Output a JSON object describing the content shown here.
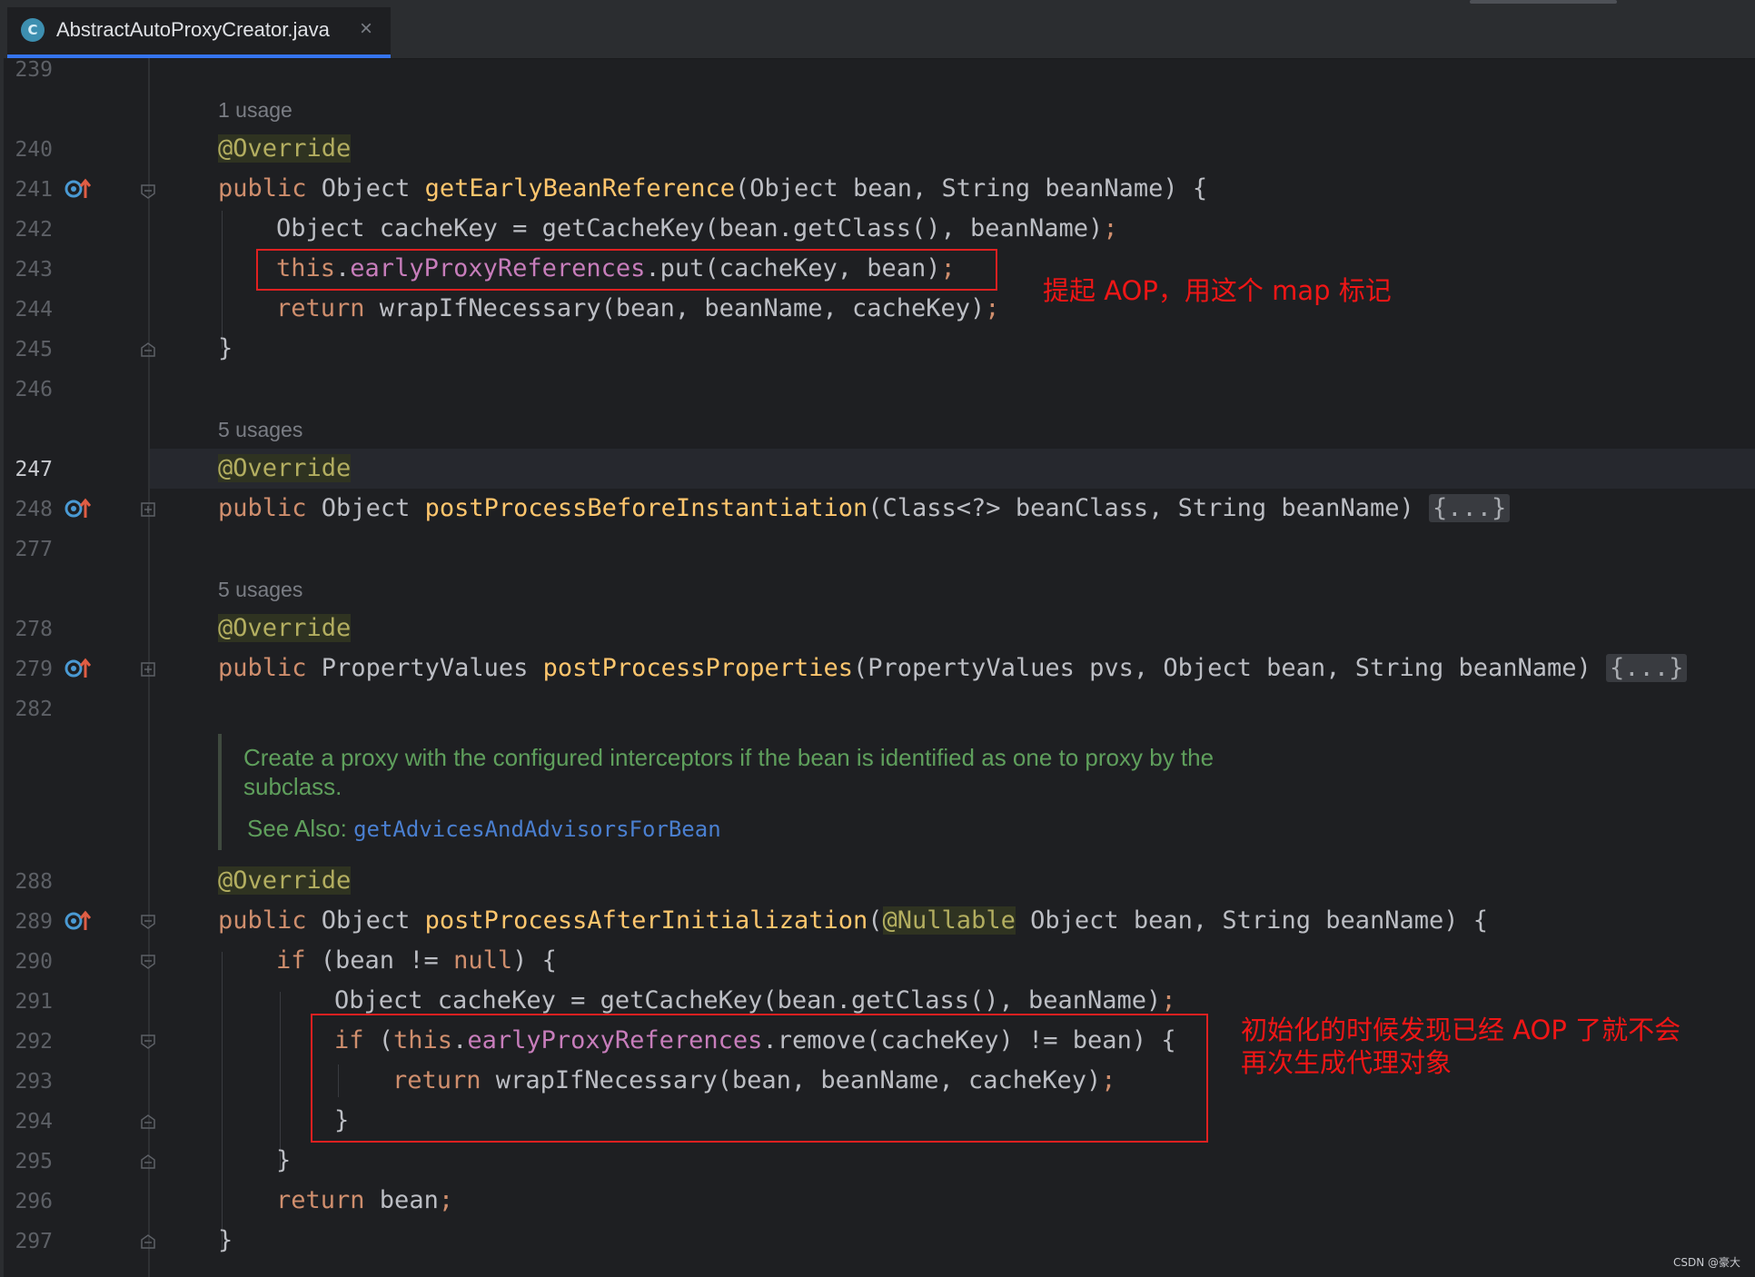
{
  "tab": {
    "icon_letter": "C",
    "title": "AbstractAutoProxyCreator.java",
    "close_glyph": "×"
  },
  "line_numbers": {
    "l239": "239",
    "l240": "240",
    "l241": "241",
    "l242": "242",
    "l243": "243",
    "l244": "244",
    "l245": "245",
    "l246": "246",
    "l247": "247",
    "l248": "248",
    "l277": "277",
    "l278": "278",
    "l279": "279",
    "l282": "282",
    "l288": "288",
    "l289": "289",
    "l290": "290",
    "l291": "291",
    "l292": "292",
    "l293": "293",
    "l294": "294",
    "l295": "295",
    "l296": "296",
    "l297": "297"
  },
  "hints": {
    "usage1": "1 usage",
    "usages5a": "5 usages",
    "usages5b": "5 usages"
  },
  "code": {
    "l240_ann": "@Override",
    "l241_pub": "public",
    "l241_type": " Object ",
    "l241_name": "getEarlyBeanReference",
    "l241_rest": "(Object bean, String beanName) {",
    "l242_a": "Object cacheKey = getCacheKey(bean.getClass(), beanName)",
    "l242_semi": ";",
    "l243_this": "this",
    "l243_dot": ".",
    "l243_field": "earlyProxyReferences",
    "l243_rest": ".put(cacheKey, bean)",
    "l243_semi": ";",
    "l244_ret": "return",
    "l244_rest": " wrapIfNecessary(bean, beanName, cacheKey)",
    "l244_semi": ";",
    "l245": "}",
    "l247_ann": "@Override",
    "l248_pub": "public",
    "l248_type": " Object ",
    "l248_name": "postProcessBeforeInstantiation",
    "l248_rest": "(Class<?> beanClass, String beanName) ",
    "l248_fold": "{...}",
    "l278_ann": "@Override",
    "l279_pub": "public",
    "l279_type": " PropertyValues ",
    "l279_name": "postProcessProperties",
    "l279_rest": "(PropertyValues pvs, Object bean, String beanName) ",
    "l279_fold": "{...}",
    "l288_ann": "@Override",
    "l289_pub": "public",
    "l289_type": " Object ",
    "l289_name": "postProcessAfterInitialization",
    "l289_p": "(",
    "l289_ann": "@Nullable",
    "l289_rest": " Object bean, String beanName) {",
    "l290_if": "if",
    "l290_a": " (bean != ",
    "l290_null": "null",
    "l290_b": ") {",
    "l291_a": "Object cacheKey = getCacheKey(bean.getClass(), beanName)",
    "l291_semi": ";",
    "l292_if": "if",
    "l292_a": " (",
    "l292_this": "this",
    "l292_dot": ".",
    "l292_field": "earlyProxyReferences",
    "l292_rest": ".remove(cacheKey) != bean) {",
    "l293_ret": "return",
    "l293_rest": " wrapIfNecessary(bean, beanName, cacheKey)",
    "l293_semi": ";",
    "l294": "}",
    "l295": "}",
    "l296_ret": "return",
    "l296_rest": " bean",
    "l296_semi": ";",
    "l297": "}"
  },
  "doc": {
    "line1": "Create a proxy with the configured interceptors if the bean is identified as one to proxy by the",
    "line2": "subclass.",
    "see_also_label": "See Also: ",
    "see_also_link": "getAdvicesAndAdvisorsForBean"
  },
  "annotations": {
    "note1": "提起 AOP，用这个 map 标记",
    "note2_line1": "初始化的时候发现已经 AOP 了就不会",
    "note2_line2": "再次生成代理对象"
  },
  "watermark": "CSDN @豪大",
  "colors": {
    "background": "#1e1f22",
    "keyword": "#cf8e6d",
    "method": "#ffc66d",
    "annotation": "#b3ae60",
    "field": "#c77dbb",
    "doc": "#5f9f5c",
    "link": "#4a7fd0",
    "note_red": "#f01616"
  },
  "icons": {
    "gutter": "override-up-icon",
    "fold": "fold-icon"
  }
}
